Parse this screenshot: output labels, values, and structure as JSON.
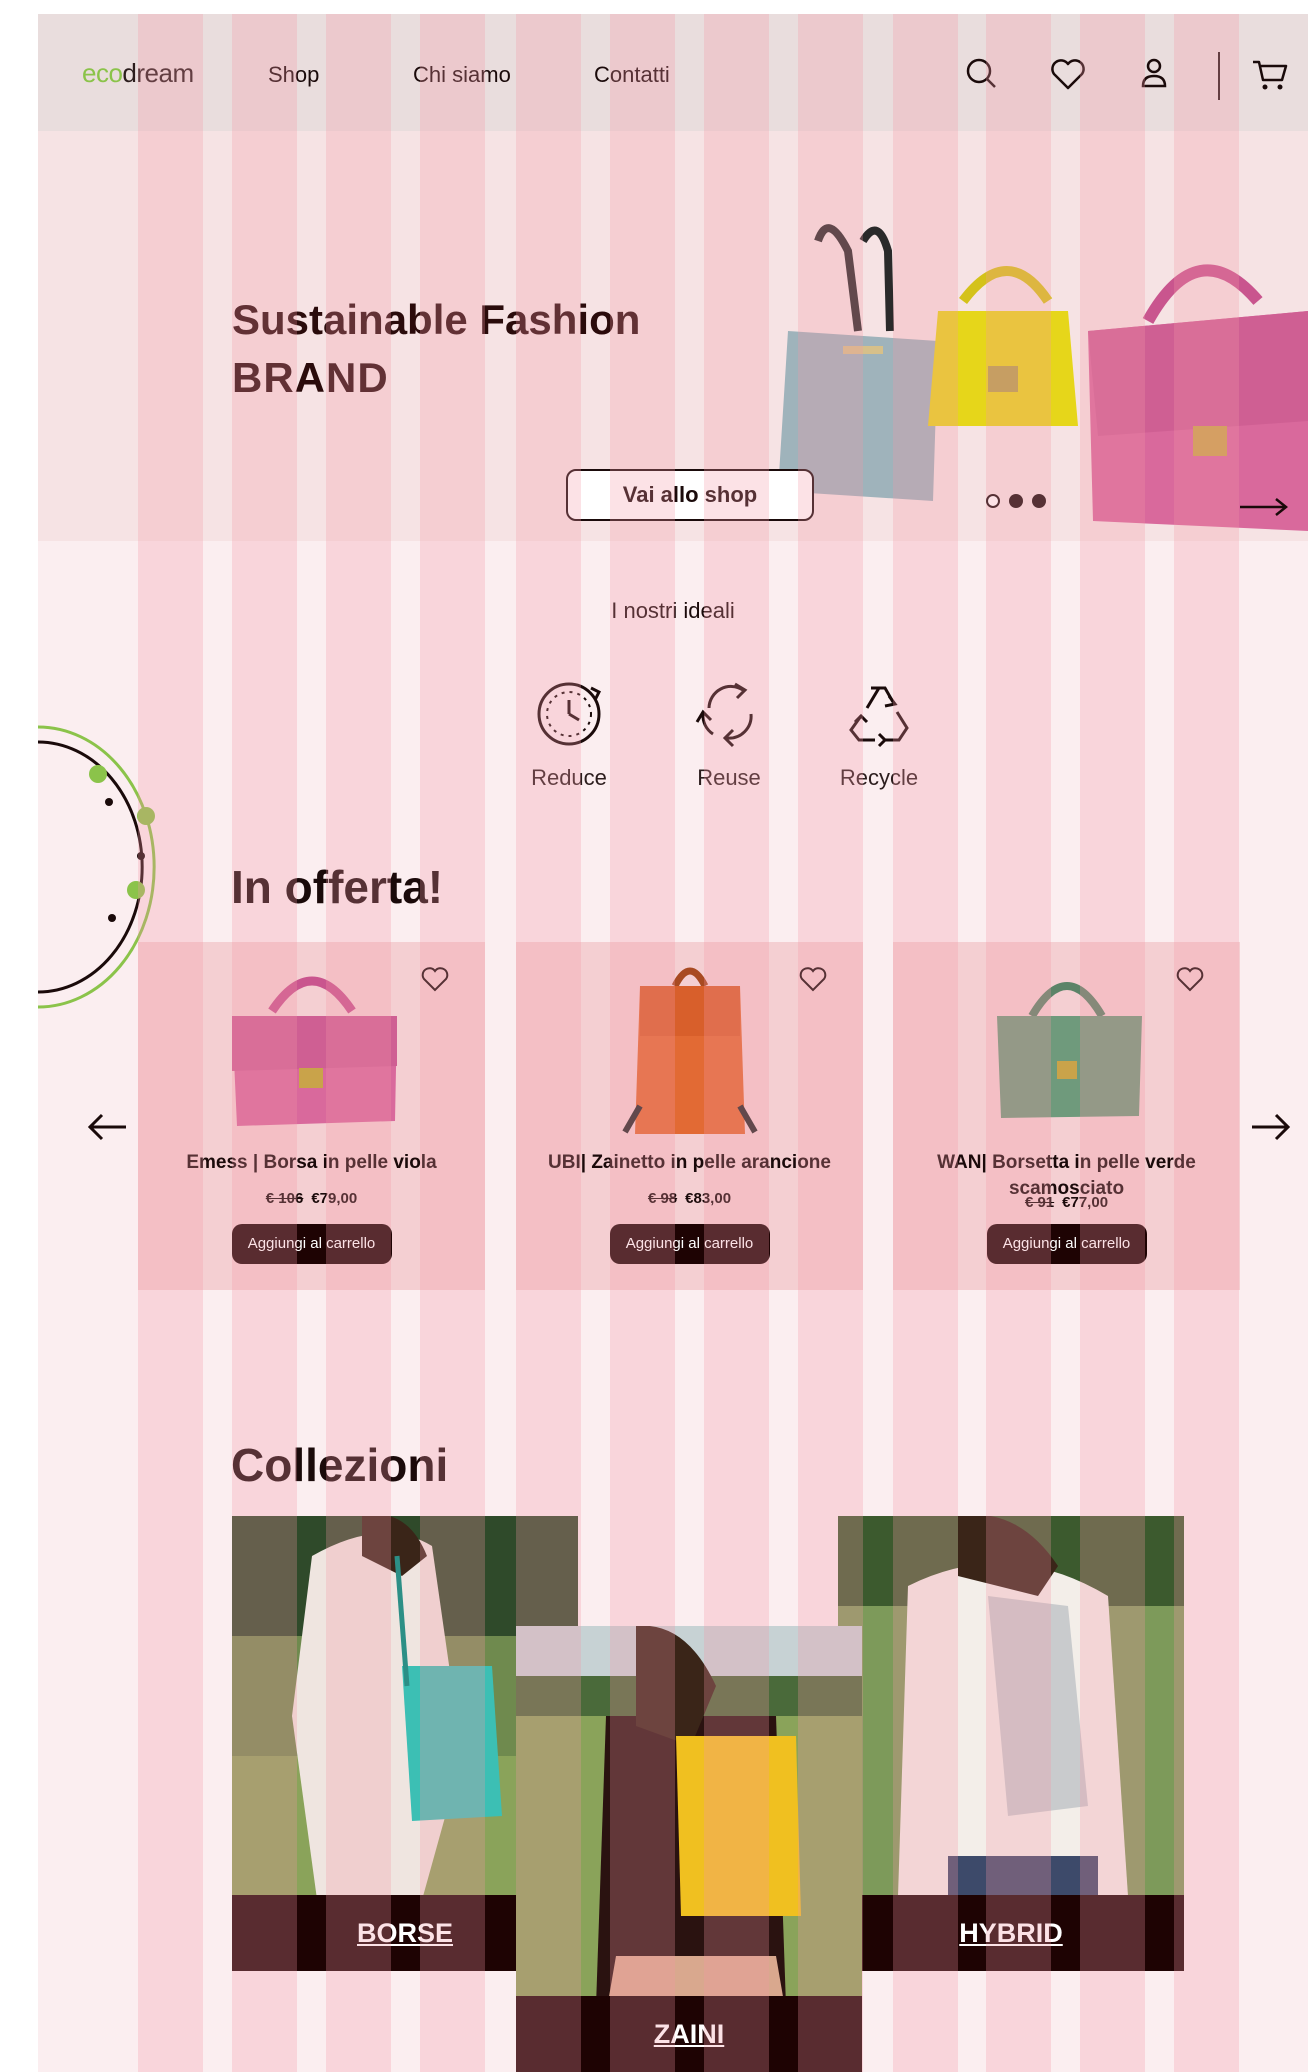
{
  "header": {
    "logo_eco": "eco",
    "logo_dream": "dream",
    "nav": [
      "Shop",
      "Chi siamo",
      "Contatti"
    ],
    "icons": [
      "search-icon",
      "heart-icon",
      "user-icon",
      "cart-icon"
    ]
  },
  "hero": {
    "title_line1": "Sustainable Fashion",
    "title_line2": "BRAND",
    "cta": "Vai allo shop",
    "slides": {
      "count": 3,
      "active": 1
    }
  },
  "ideals": {
    "title": "I nostri ideali",
    "items": [
      {
        "label": "Reduce",
        "icon": "clock-icon"
      },
      {
        "label": "Reuse",
        "icon": "reuse-arrows-icon"
      },
      {
        "label": "Recycle",
        "icon": "recycle-icon"
      }
    ]
  },
  "offers": {
    "title": "In offerta!",
    "products": [
      {
        "name": "Emess | Borsa in pelle viola",
        "old_price": "€ 106",
        "price": "€79,00",
        "button": "Aggiungi al carrello",
        "color": "#d9699c"
      },
      {
        "name": "UBI| Zainetto in pelle arancione",
        "old_price": "€ 98",
        "price": "€83,00",
        "button": "Aggiungi al carrello",
        "color": "#e26a34"
      },
      {
        "name": "WAN| Borsetta in pelle verde scamosciato",
        "old_price": "€ 91",
        "price": "€77,00",
        "button": "Aggiungi al carrello",
        "color": "#6f9a7c"
      }
    ]
  },
  "collections": {
    "title": "Collezioni",
    "items": [
      {
        "label": "BORSE"
      },
      {
        "label": "ZAINI"
      },
      {
        "label": "HYBRID"
      }
    ]
  },
  "colors": {
    "dark": "#1e0303",
    "accent_green": "#8bc34a",
    "hero_bg": "#f6e3e4"
  }
}
